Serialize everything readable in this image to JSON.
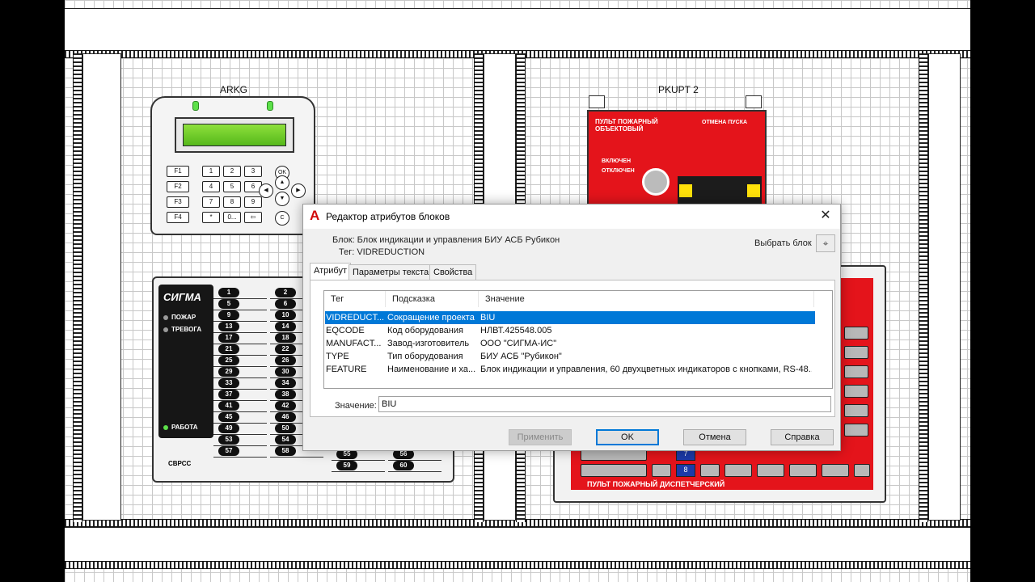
{
  "drawing": {
    "device_arkg_label": "ARKG",
    "device_pkupt_label": "PKUPT 2",
    "sigma": {
      "logo": "СИГМА",
      "lamps": [
        "ПОЖАР",
        "ТРЕВОГА",
        "РАБОТА"
      ],
      "bottom_label": "СВРСС",
      "zones_col1": [
        "1",
        "5",
        "9",
        "13",
        "17",
        "21",
        "25",
        "29",
        "33",
        "37",
        "41",
        "45",
        "49",
        "53",
        "57"
      ],
      "zones_col2": [
        "2",
        "6",
        "10",
        "14",
        "18",
        "22",
        "26",
        "30",
        "34",
        "38",
        "42",
        "46",
        "50",
        "54",
        "58"
      ],
      "zones_col3": [
        "55",
        "59"
      ],
      "zones_col4": [
        "56",
        "60"
      ]
    },
    "arkg_keys": [
      "F1",
      "1",
      "2",
      "3",
      "F2",
      "4",
      "5",
      "6",
      "F3",
      "7",
      "8",
      "9",
      "F4",
      "*",
      "0...",
      "⇦",
      "OK",
      "C"
    ],
    "pkupt_panel_title": "ПУЛЬТ ПОЖАРНЫЙ ОБЪЕКТОВЫЙ",
    "pkupt_panel_top_right": "ОТМЕНА ПУСКА",
    "pkupt_status": [
      "ВКЛЮЧЕН",
      "ОТКЛЮЧЕН"
    ],
    "pult_footer": "ПУЛЬТ ПОЖАРНЫЙ ДИСПЕТЧЕРСКИЙ",
    "pult_blue_keys": [
      "7",
      "8"
    ]
  },
  "dialog": {
    "title": "Редактор атрибутов блоков",
    "block_line": "Блок: Блок индикации и управления БИУ АСБ Рубикон",
    "tag_line": "Тег: VIDREDUCTION",
    "pick_block_label": "Выбрать блок",
    "tabs": [
      "Атрибут",
      "Параметры текста",
      "Свойства"
    ],
    "columns": [
      "Тег",
      "Подсказка",
      "Значение"
    ],
    "rows": [
      {
        "tag": "VIDREDUCT...",
        "prompt": "Сокращение проекта",
        "value": "BIU"
      },
      {
        "tag": "EQCODE",
        "prompt": "Код оборудования",
        "value": "НЛВТ.425548.005"
      },
      {
        "tag": "MANUFACT...",
        "prompt": "Завод-изготовитель",
        "value": "ООО \"СИГМА-ИС\""
      },
      {
        "tag": "TYPE",
        "prompt": "Тип оборудования",
        "value": "БИУ АСБ \"Рубикон\""
      },
      {
        "tag": "FEATURE",
        "prompt": "Наименование и ха...",
        "value": "Блок индикации и управления, 60 двухцветных индикаторов с кнопками, RS-48..."
      }
    ],
    "selected_row": 0,
    "value_label": "Значение:",
    "value_input": "BIU",
    "buttons": {
      "apply": "Применить",
      "ok": "OK",
      "cancel": "Отмена",
      "help": "Справка"
    }
  },
  "colors": {
    "selection": "#0078d7",
    "panel_red": "#e4141b",
    "lcd_green": "#7fd832",
    "app_icon_red": "#d10a0a"
  },
  "icons": {
    "app": "autocad-a-icon",
    "close": "close-icon",
    "pick": "crosshair-icon"
  }
}
